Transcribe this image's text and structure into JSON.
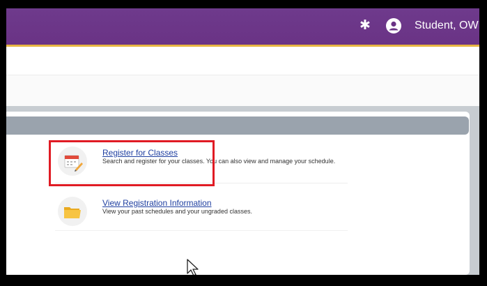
{
  "header": {
    "user_name": "Student, OWL",
    "settings_icon": "gear-icon",
    "user_icon": "user-avatar-icon"
  },
  "menu": {
    "items": [
      {
        "title": "Register for Classes",
        "description": "Search and register for your classes. You can also view and manage your schedule.",
        "icon": "calendar-pencil-icon"
      },
      {
        "title": "View Registration Information",
        "description": "View your past schedules and your ungraded classes.",
        "icon": "folder-icon"
      }
    ]
  },
  "colors": {
    "topbar": "#6a3385",
    "accent_stripe": "#e7b542",
    "link": "#1f3fa0",
    "highlight_box": "#e01b24"
  }
}
